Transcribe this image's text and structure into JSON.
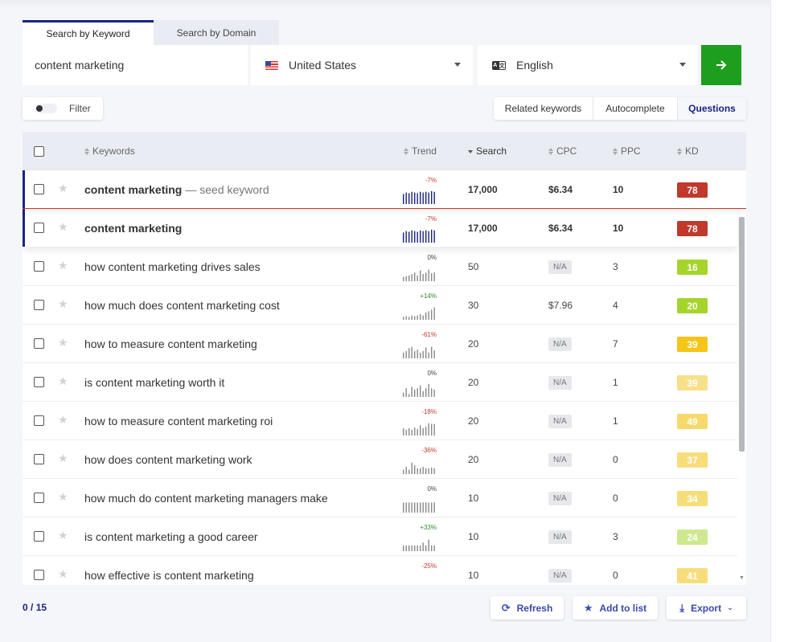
{
  "tabs": [
    {
      "label": "Search by Keyword",
      "active": true
    },
    {
      "label": "Search by Domain",
      "active": false
    }
  ],
  "search": {
    "keyword_value": "content marketing",
    "country": "United States",
    "language": "English",
    "go_icon": "arrow-right-icon"
  },
  "filter": {
    "label": "Filter"
  },
  "modes": {
    "related": "Related keywords",
    "autocomplete": "Autocomplete",
    "questions": "Questions",
    "active": "Questions"
  },
  "columns": {
    "keywords": "Keywords",
    "trend": "Trend",
    "search": "Search",
    "cpc": "CPC",
    "ppc": "PPC",
    "kd": "KD"
  },
  "seed": {
    "keyword": "content marketing",
    "suffix": "— seed keyword",
    "trend_pct": "-7%",
    "trend": [
      0.7,
      0.8,
      0.75,
      0.85,
      0.8,
      0.75,
      0.85,
      0.8,
      0.85,
      0.8,
      0.9,
      0.85
    ],
    "search": "17,000",
    "cpc": "$6.34",
    "ppc": "10",
    "kd": "78"
  },
  "rows": [
    {
      "keyword": "content marketing",
      "bold": true,
      "trend_pct": "-7%",
      "trend": [
        0.7,
        0.8,
        0.75,
        0.85,
        0.8,
        0.75,
        0.85,
        0.8,
        0.85,
        0.8,
        0.9,
        0.85
      ],
      "search": "17,000",
      "cpc": "$6.34",
      "ppc": "10",
      "kd": "78"
    },
    {
      "keyword": "how content marketing drives sales",
      "bold": false,
      "trend_pct": "0%",
      "trend": [
        0.3,
        0.35,
        0.4,
        0.5,
        0.6,
        0.4,
        0.75,
        0.5,
        0.6,
        0.8,
        0.55,
        0.6
      ],
      "search": "50",
      "cpc": "N/A",
      "ppc": "3",
      "kd": "16"
    },
    {
      "keyword": "how much does content marketing cost",
      "bold": false,
      "trend_pct": "+14%",
      "trend": [
        0.2,
        0.25,
        0.2,
        0.3,
        0.25,
        0.3,
        0.4,
        0.3,
        0.5,
        0.6,
        0.7,
        0.85
      ],
      "search": "30",
      "cpc": "$7.96",
      "ppc": "4",
      "kd": "20"
    },
    {
      "keyword": "how to measure content marketing",
      "bold": false,
      "trend_pct": "-61%",
      "trend": [
        0.4,
        0.5,
        0.7,
        0.8,
        0.5,
        0.6,
        0.4,
        0.5,
        0.75,
        0.4,
        0.8,
        0.55
      ],
      "search": "20",
      "cpc": "N/A",
      "ppc": "7",
      "kd": "39"
    },
    {
      "keyword": "is content marketing worth it",
      "bold": false,
      "trend_pct": "0%",
      "trend": [
        0.3,
        0.6,
        0.2,
        0.7,
        0.5,
        0.6,
        0.8,
        0.4,
        0.6,
        0.9,
        0.6,
        0.5
      ],
      "search": "20",
      "cpc": "N/A",
      "ppc": "1",
      "kd": "39"
    },
    {
      "keyword": "how to measure content marketing roi",
      "bold": false,
      "trend_pct": "-18%",
      "trend": [
        0.5,
        0.4,
        0.5,
        0.4,
        0.55,
        0.45,
        0.7,
        0.5,
        0.6,
        0.85,
        0.8,
        0.8
      ],
      "search": "20",
      "cpc": "N/A",
      "ppc": "1",
      "kd": "49"
    },
    {
      "keyword": "how does content marketing work",
      "bold": false,
      "trend_pct": "-36%",
      "trend": [
        0.3,
        0.5,
        0.3,
        0.8,
        0.6,
        0.4,
        0.4,
        0.5,
        0.4,
        0.4,
        0.45,
        0.4
      ],
      "search": "20",
      "cpc": "N/A",
      "ppc": "0",
      "kd": "37"
    },
    {
      "keyword": "how much do content marketing managers make",
      "bold": false,
      "trend_pct": "0%",
      "trend": [
        0.7,
        0.7,
        0.7,
        0.7,
        0.7,
        0.7,
        0.7,
        0.7,
        0.7,
        0.7,
        0.7,
        0.7
      ],
      "search": "10",
      "cpc": "N/A",
      "ppc": "0",
      "kd": "34"
    },
    {
      "keyword": "is content marketing a good career",
      "bold": false,
      "trend_pct": "+33%",
      "trend": [
        0.4,
        0.4,
        0.4,
        0.4,
        0.4,
        0.4,
        0.4,
        0.6,
        0.4,
        0.8,
        0.4,
        0.4
      ],
      "search": "10",
      "cpc": "N/A",
      "ppc": "3",
      "kd": "24"
    },
    {
      "keyword": "how effective is content marketing",
      "bold": false,
      "trend_pct": "-25%",
      "trend": [
        0.0,
        0.0,
        0.0,
        0.0,
        0.0,
        0.0,
        0.0,
        0.0,
        0.0,
        0.0,
        0.0,
        0.0
      ],
      "search": "10",
      "cpc": "N/A",
      "ppc": "0",
      "kd": "41"
    }
  ],
  "kd_colors": {
    "78": "#c0392b",
    "16": "#a5d42b",
    "20": "#a5d42b",
    "39a": "#f5c518",
    "39b": "#f7e08a",
    "49": "#f6d96a",
    "37": "#f7dd7a",
    "34": "#f7dd7a",
    "24": "#cde88f",
    "41": "#f7dd7a"
  },
  "footer": {
    "selected": "0",
    "separator": "/",
    "total": "15",
    "refresh": "Refresh",
    "add_to_list": "Add to list",
    "export": "Export"
  },
  "colors": {
    "accent": "#1a237e",
    "go": "#1e9e1e",
    "action": "#3949ab"
  }
}
